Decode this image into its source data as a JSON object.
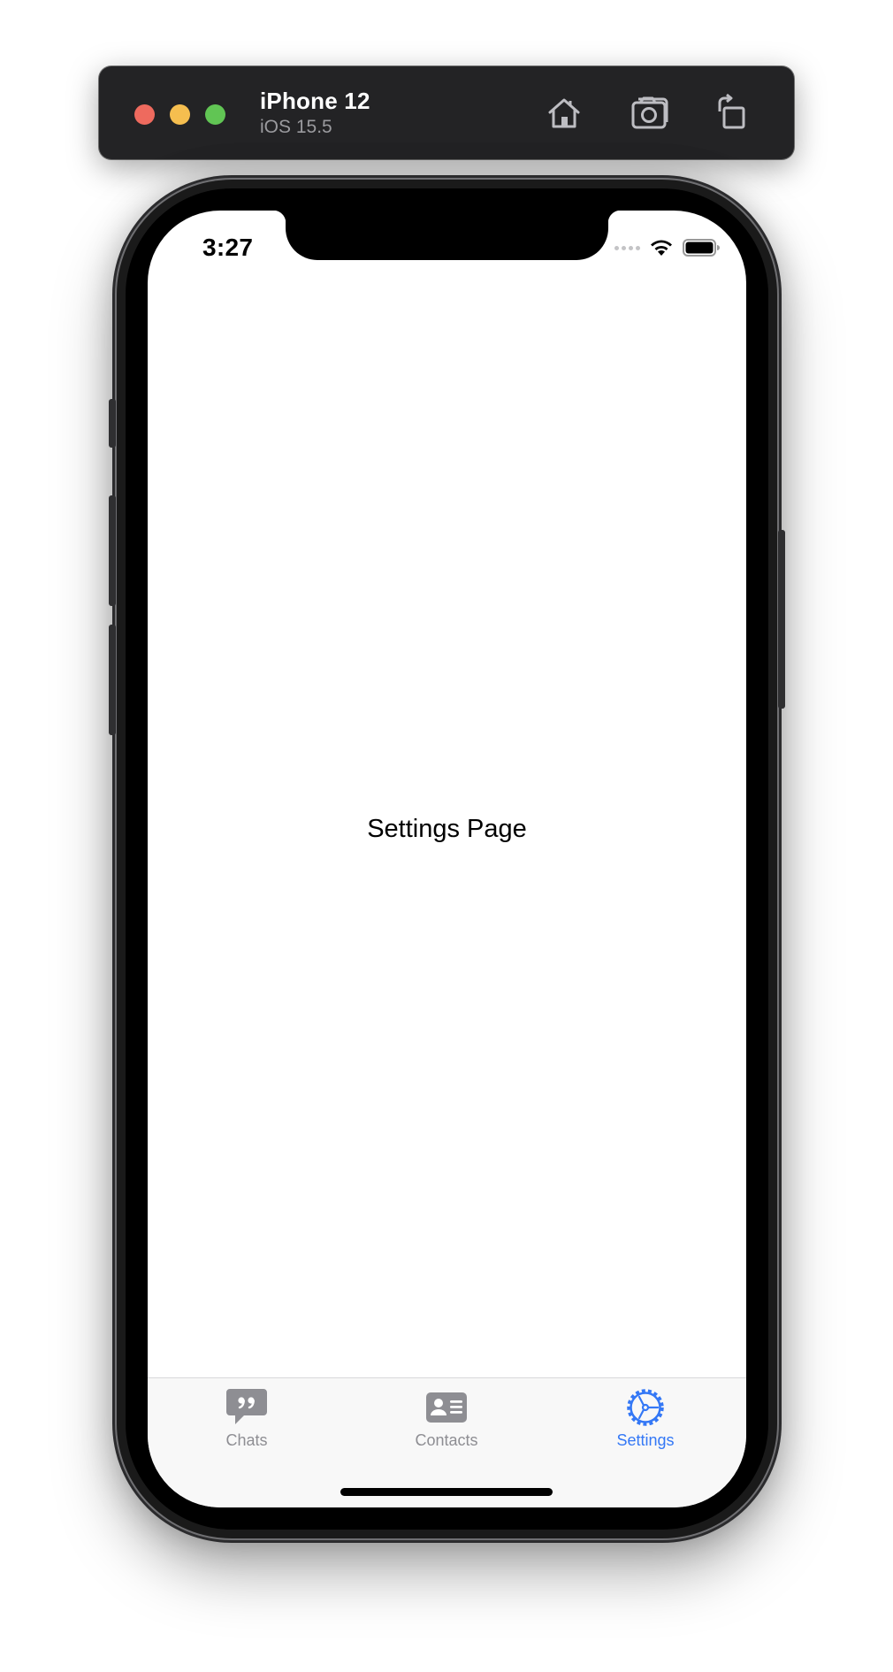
{
  "simulator": {
    "device_name": "iPhone 12",
    "os_version": "iOS 15.5",
    "toolbar_icons": [
      "home-icon",
      "screenshot-icon",
      "rotate-icon"
    ]
  },
  "status_bar": {
    "time": "3:27",
    "icons": [
      "cellular-signal-icon",
      "wifi-icon",
      "battery-icon"
    ]
  },
  "main": {
    "page_label": "Settings Page"
  },
  "tabbar": {
    "tabs": [
      {
        "label": "Chats",
        "icon": "chat-quote-icon",
        "active": false
      },
      {
        "label": "Contacts",
        "icon": "contact-card-icon",
        "active": false
      },
      {
        "label": "Settings",
        "icon": "gear-icon",
        "active": true
      }
    ]
  },
  "colors": {
    "accent": "#3478f6",
    "inactive": "#8e8e93",
    "toolbar_bg": "#232325"
  }
}
